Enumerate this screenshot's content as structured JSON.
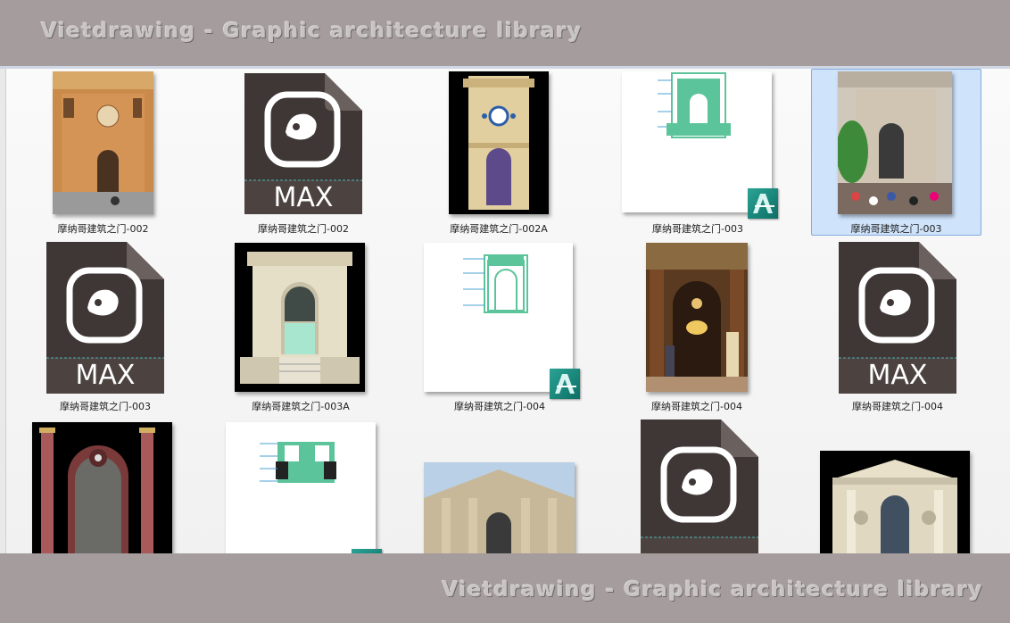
{
  "watermark": {
    "top": "Vietdrawing - Graphic architecture library",
    "bottom": "Vietdrawing - Graphic architecture library"
  },
  "max_label": "MAX",
  "files": [
    {
      "name": "摩纳哥建筑之门-002",
      "kind": "photo"
    },
    {
      "name": "摩纳哥建筑之门-002",
      "kind": "3dsmax"
    },
    {
      "name": "摩纳哥建筑之门-002A",
      "kind": "render"
    },
    {
      "name": "摩纳哥建筑之门-003",
      "kind": "autocad"
    },
    {
      "name": "摩纳哥建筑之门-003",
      "kind": "photo",
      "selected": true
    },
    {
      "name": "摩纳哥建筑之门-003",
      "kind": "3dsmax"
    },
    {
      "name": "摩纳哥建筑之门-003A",
      "kind": "render"
    },
    {
      "name": "摩纳哥建筑之门-004",
      "kind": "autocad"
    },
    {
      "name": "摩纳哥建筑之门-004",
      "kind": "photo"
    },
    {
      "name": "摩纳哥建筑之门-004",
      "kind": "3dsmax"
    },
    {
      "name": "",
      "kind": "render"
    },
    {
      "name": "",
      "kind": "autocad"
    },
    {
      "name": "",
      "kind": "photo"
    },
    {
      "name": "",
      "kind": "3dsmax"
    },
    {
      "name": "",
      "kind": "render"
    }
  ],
  "colors": {
    "banner": "#a49c9d",
    "selection": "#cfe3fb",
    "max_dark": "#3f3735",
    "autocad": "#1a8a7e",
    "drawing": "#5cc49a"
  }
}
